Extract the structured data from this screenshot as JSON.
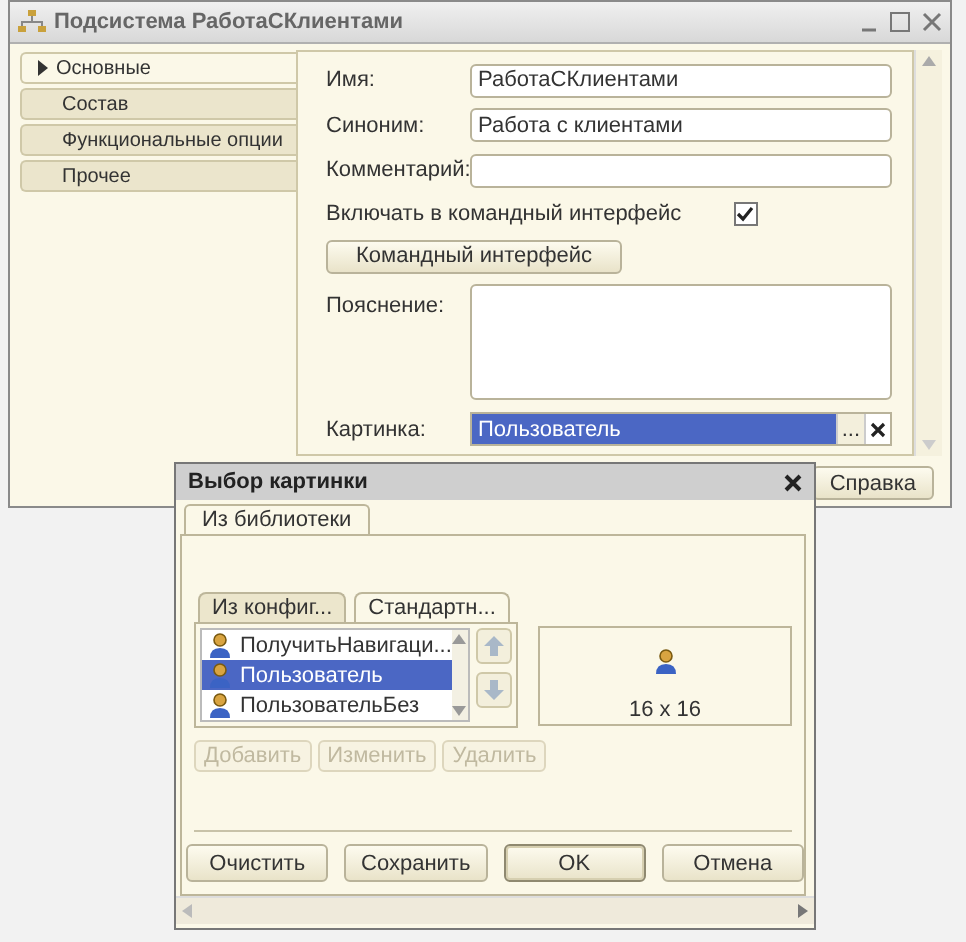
{
  "window": {
    "title": "Подсистема РаботаСКлиентами"
  },
  "tabs": [
    {
      "label": "Основные",
      "selected": true
    },
    {
      "label": "Состав",
      "selected": false
    },
    {
      "label": "Функциональные опции",
      "selected": false
    },
    {
      "label": "Прочее",
      "selected": false
    }
  ],
  "fields": [
    {
      "kind": "input",
      "label": "Имя:",
      "value": "РаботаСКлиентами"
    },
    {
      "kind": "input",
      "label": "Синоним:",
      "value": "Работа с клиентами"
    },
    {
      "kind": "input",
      "label": "Комментарий:"
    },
    {
      "kind": "checkbox",
      "label": "Включать в командный интерфейс",
      "checked": true
    },
    {
      "kind": "button",
      "label": "Командный интерфейс"
    },
    {
      "kind": "textarea",
      "label": "Пояснение:"
    },
    {
      "kind": "picker",
      "label": "Картинка:",
      "value": "Пользователь",
      "selected": true,
      "button": "..."
    }
  ],
  "help_button": "Справка",
  "dialog": {
    "title": "Выбор картинки",
    "tabs": [
      {
        "label": "Из библиотеки",
        "selected": true
      }
    ],
    "sub_tabs": [
      {
        "label": "Из конфиг...",
        "selected": false
      },
      {
        "label": "Стандартн...",
        "selected": true
      }
    ],
    "items": [
      {
        "label": "ПолучитьНавигаци...",
        "selected": false
      },
      {
        "label": "Пользователь",
        "selected": true
      },
      {
        "label": "ПользовательБез",
        "selected": false
      }
    ],
    "preview_size": "16 x 16",
    "actions": [
      {
        "label": "Добавить",
        "disabled": true
      },
      {
        "label": "Изменить",
        "disabled": true
      },
      {
        "label": "Удалить",
        "disabled": true
      }
    ],
    "buttons": [
      {
        "label": "Очистить",
        "default": false
      },
      {
        "label": "Сохранить",
        "default": false
      },
      {
        "label": "OK",
        "default": true
      },
      {
        "label": "Отмена",
        "default": false
      }
    ]
  }
}
